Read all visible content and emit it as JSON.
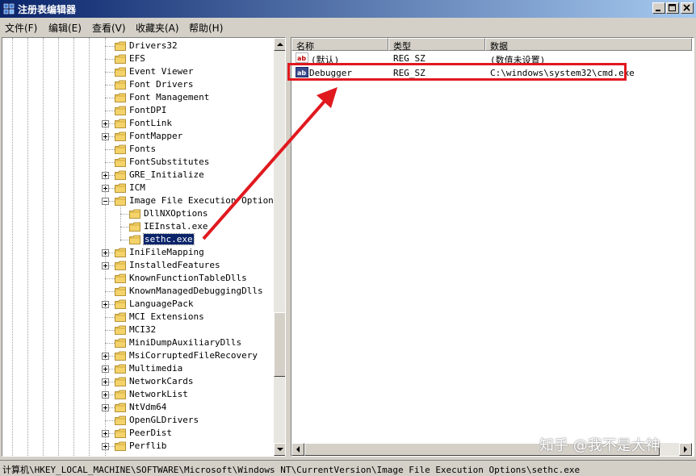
{
  "window": {
    "title": "注册表编辑器"
  },
  "menu": [
    "文件(F)",
    "编辑(E)",
    "查看(V)",
    "收藏夹(A)",
    "帮助(H)"
  ],
  "tree": [
    {
      "label": "Drivers32",
      "exp": ""
    },
    {
      "label": "EFS",
      "exp": ""
    },
    {
      "label": "Event Viewer",
      "exp": ""
    },
    {
      "label": "Font Drivers",
      "exp": ""
    },
    {
      "label": "Font Management",
      "exp": ""
    },
    {
      "label": "FontDPI",
      "exp": ""
    },
    {
      "label": "FontLink",
      "exp": "plus"
    },
    {
      "label": "FontMapper",
      "exp": "plus"
    },
    {
      "label": "Fonts",
      "exp": ""
    },
    {
      "label": "FontSubstitutes",
      "exp": ""
    },
    {
      "label": "GRE_Initialize",
      "exp": "plus"
    },
    {
      "label": "ICM",
      "exp": "plus"
    },
    {
      "label": "Image File Execution Options",
      "exp": "minus"
    },
    {
      "label": "DllNXOptions",
      "exp": "",
      "child": true
    },
    {
      "label": "IEInstal.exe",
      "exp": "",
      "child": true
    },
    {
      "label": "sethc.exe",
      "exp": "",
      "child": true,
      "selected": true
    },
    {
      "label": "IniFileMapping",
      "exp": "plus"
    },
    {
      "label": "InstalledFeatures",
      "exp": "plus"
    },
    {
      "label": "KnownFunctionTableDlls",
      "exp": ""
    },
    {
      "label": "KnownManagedDebuggingDlls",
      "exp": ""
    },
    {
      "label": "LanguagePack",
      "exp": "plus"
    },
    {
      "label": "MCI Extensions",
      "exp": ""
    },
    {
      "label": "MCI32",
      "exp": ""
    },
    {
      "label": "MiniDumpAuxiliaryDlls",
      "exp": ""
    },
    {
      "label": "MsiCorruptedFileRecovery",
      "exp": "plus"
    },
    {
      "label": "Multimedia",
      "exp": "plus"
    },
    {
      "label": "NetworkCards",
      "exp": "plus"
    },
    {
      "label": "NetworkList",
      "exp": "plus"
    },
    {
      "label": "NtVdm64",
      "exp": "plus"
    },
    {
      "label": "OpenGLDrivers",
      "exp": ""
    },
    {
      "label": "PeerDist",
      "exp": "plus"
    },
    {
      "label": "Perflib",
      "exp": "plus"
    }
  ],
  "list": {
    "columns": [
      "名称",
      "类型",
      "数据"
    ],
    "rows": [
      {
        "name": "(默认)",
        "type": "REG_SZ",
        "data": "(数值未设置)"
      },
      {
        "name": "Debugger",
        "type": "REG_SZ",
        "data": "C:\\windows\\system32\\cmd.exe"
      }
    ]
  },
  "status": "计算机\\HKEY_LOCAL_MACHINE\\SOFTWARE\\Microsoft\\Windows NT\\CurrentVersion\\Image File Execution Options\\sethc.exe",
  "watermark": "知乎 @我不是大神",
  "colors": {
    "title_start": "#0a246a",
    "title_end": "#a6caf0",
    "selection": "#0a246a",
    "highlight_box": "#e0191f",
    "folder": "#f5d36b"
  }
}
